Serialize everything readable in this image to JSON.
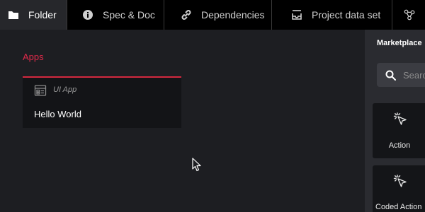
{
  "tabs": [
    {
      "label": "Folder",
      "icon": "folder-icon",
      "active": true
    },
    {
      "label": "Spec & Doc",
      "icon": "info-icon",
      "active": false
    },
    {
      "label": "Dependencies",
      "icon": "link-icon",
      "active": false
    },
    {
      "label": "Project data set",
      "icon": "dataset-icon",
      "active": false
    },
    {
      "label": "",
      "icon": "graph-nodes-icon",
      "active": false
    }
  ],
  "main": {
    "section_title": "Apps",
    "app_card": {
      "kind": "UI App",
      "name": "Hello World"
    }
  },
  "marketplace": {
    "title": "Marketplace",
    "search_placeholder": "Search",
    "items": [
      {
        "label": "Action",
        "icon": "click-pointer-icon"
      },
      {
        "label": "Coded Action",
        "icon": "click-pointer-icon"
      }
    ]
  },
  "colors": {
    "accent": "#e0294a",
    "tabbar_bg": "#000000",
    "active_tab_bg": "#26272b",
    "main_bg": "#1d1e22",
    "panel_bg": "#2a2b30",
    "card_bg": "#131417"
  }
}
